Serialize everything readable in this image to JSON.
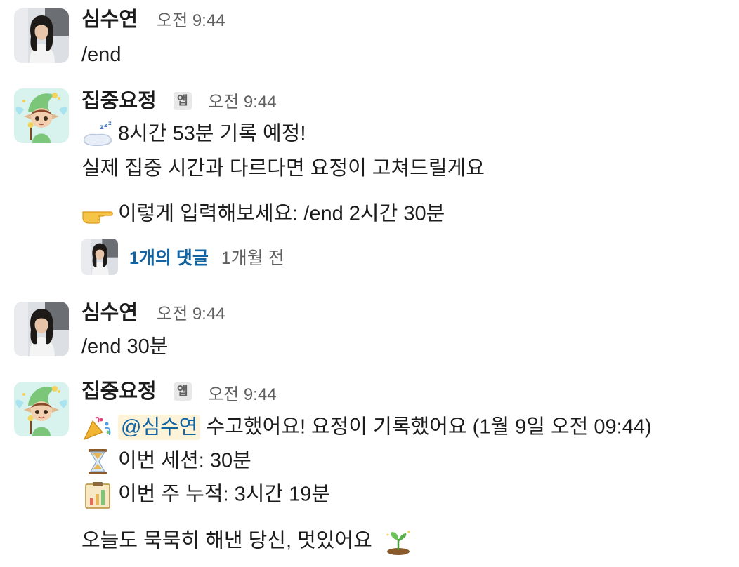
{
  "messages": [
    {
      "sender": "심수연",
      "time": "오전 9:44",
      "lines": [
        "/end"
      ]
    },
    {
      "sender": "집중요정",
      "badge": "앱",
      "time": "오전 9:44",
      "lines": [
        "8시간 53분 기록 예정!",
        "실제 집중 시간과 다르다면 요정이 고쳐드릴게요",
        "이렇게 입력해보세요: /end 2시간 30분"
      ],
      "thread": {
        "replies": "1개의 댓글",
        "ago": "1개월 전"
      }
    },
    {
      "sender": "심수연",
      "time": "오전 9:44",
      "lines": [
        "/end 30분"
      ]
    },
    {
      "sender": "집중요정",
      "badge": "앱",
      "time": "오전 9:44",
      "mention": "@심수연",
      "lines": [
        "수고했어요! 요정이 기록했어요 (1월 9일 오전 09:44)",
        "이번 세션: 30분",
        "이번 주 누적: 3시간 19분",
        "오늘도 묵묵히 해낸 당신, 멋있어요"
      ]
    }
  ],
  "icons": {
    "sleep": "sleeping-pillow-emoji",
    "point": "backhand-index-pointing-right-emoji",
    "party": "party-popper-emoji",
    "hourglass": "hourglass-emoji",
    "chart": "bar-chart-clipboard-emoji",
    "sprout": "seedling-emoji"
  },
  "colors": {
    "link": "#1264a3",
    "mention_bg": "#fdf3d9",
    "muted": "#616061"
  }
}
